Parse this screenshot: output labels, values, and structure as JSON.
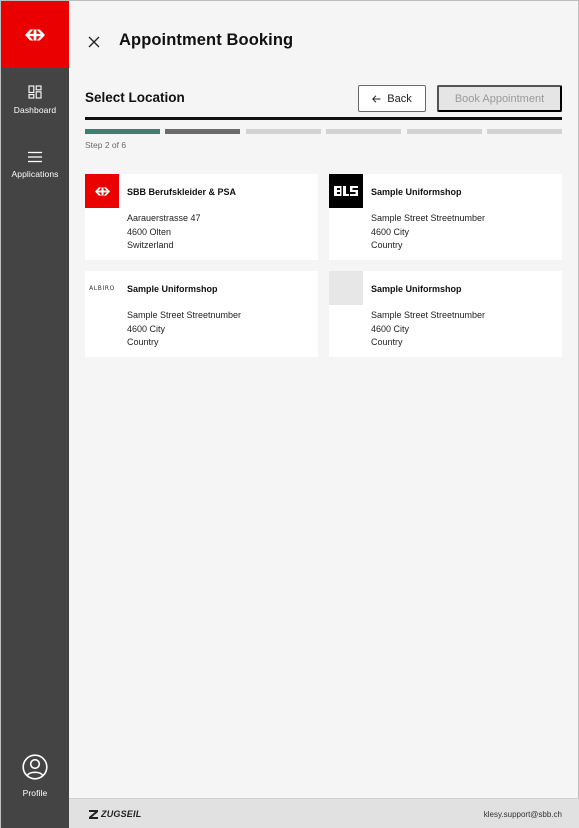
{
  "header": {
    "title": "Appointment Booking",
    "close_icon": "close-icon"
  },
  "sidebar": {
    "brand_icon": "sbb-logo-icon",
    "brand_color": "#eb0000",
    "items": [
      {
        "label": "Dashboard",
        "icon": "dashboard-icon"
      },
      {
        "label": "Applications",
        "icon": "menu-icon"
      }
    ],
    "profile": {
      "label": "Profile",
      "icon": "user-icon"
    }
  },
  "main": {
    "section_title": "Select Location",
    "back_label": "Back",
    "book_label": "Book Appointment",
    "progress": {
      "current_step": 2,
      "total_steps": 6,
      "label": "Step 2 of 6"
    },
    "accent_color": "#3d7f6f",
    "locations": [
      {
        "name": "SBB Berufskleider & PSA",
        "line1": "Aarauerstrasse 47",
        "line2": "4600 Olten",
        "line3": "Switzerland",
        "logo": "sbb-logo"
      },
      {
        "name": "Sample Uniformshop",
        "line1": "Sample Street Streetnumber",
        "line2": "4600 City",
        "line3": "Country",
        "logo": "bls-logo",
        "logo_text": "BLS"
      },
      {
        "name": "Sample Uniformshop",
        "line1": "Sample Street Streetnumber",
        "line2": "4600 City",
        "line3": "Country",
        "logo": "albiro-logo",
        "logo_text": "ALBIRO"
      },
      {
        "name": "Sample Uniformshop",
        "line1": "Sample Street Streetnumber",
        "line2": "4600 City",
        "line3": "Country",
        "logo": "placeholder-logo"
      }
    ]
  },
  "footer": {
    "brand": "ZUGSEIL",
    "support_email": "klesy.support@sbb.ch"
  }
}
